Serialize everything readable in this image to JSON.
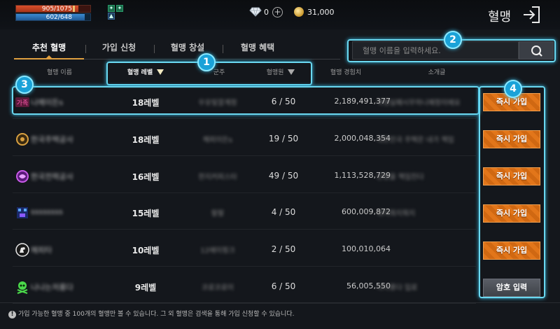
{
  "status": {
    "hp_text": "905/1075",
    "hp_fraction": 0.842,
    "mp_text": "602/648",
    "mp_fraction": 0.929
  },
  "currency": {
    "diamond": "0",
    "gold": "31,000"
  },
  "header": {
    "title": "혈맹"
  },
  "tabs": [
    {
      "label": "추천 혈맹",
      "active": true
    },
    {
      "label": "가입 신청",
      "active": false
    },
    {
      "label": "혈맹 창설",
      "active": false
    },
    {
      "label": "혈맹 혜택",
      "active": false
    }
  ],
  "search": {
    "placeholder": "혈맹 이름을 입력하세요."
  },
  "table": {
    "headers": [
      "혈맹 이름",
      "혈맹 레벨",
      "군주",
      "혈맹원",
      "혈맹 경험치",
      "소개글"
    ],
    "rows": [
      {
        "emblem": "text-emblem",
        "name": "나메이든s",
        "level": "18레벨",
        "leader": "우유빛깔계정",
        "members": "6 / 50",
        "exp": "2,189,491,377",
        "intro": "혁명실패시무하니예정이에요",
        "action": "즉시 가입"
      },
      {
        "emblem": "gold-wheel",
        "name": "한국주택공사",
        "level": "18레벨",
        "leader": "해피이든s",
        "members": "19 / 50",
        "exp": "2,000,048,354",
        "intro": "대한민국 주택은 내가 책임",
        "action": "즉시 가입"
      },
      {
        "emblem": "purple-orb",
        "name": "한국전력공사",
        "level": "16레벨",
        "leader": "한지커피스타",
        "members": "49 / 50",
        "exp": "1,113,528,729",
        "intro": "난방을 책임진다",
        "action": "즉시 가입"
      },
      {
        "emblem": "blue-pixel",
        "name": "ssssssss",
        "level": "15레벨",
        "leader": "랄랄",
        "members": "4 / 50",
        "exp": "600,009,872",
        "intro": "뭐지뭐지뭐지",
        "action": "즉시 가입"
      },
      {
        "emblem": "horse-badge",
        "name": "해피타",
        "level": "10레벨",
        "leader": "12에이핑크",
        "members": "2 / 50",
        "exp": "100,010,064",
        "intro": "",
        "action": "즉시 가입"
      },
      {
        "emblem": "green-skull",
        "name": "나나는저롱다",
        "level": "9레벨",
        "leader": "코로코로이",
        "members": "6 / 50",
        "exp": "56,005,550",
        "intro": "나나롱다 입로",
        "action": "암호 입력"
      }
    ]
  },
  "footer": {
    "notice": "가입 가능한 혈맹 중 100개의 혈맹만 볼 수 있습니다. 그 외 혈맹은 검색을 통해 가입 신청할 수 있습니다."
  },
  "callouts": [
    "1",
    "2",
    "3",
    "4"
  ],
  "colors": {
    "accent": "#e0a040",
    "join_button": "#e2761a",
    "callout": "#1aa2d8",
    "background": "#14171c"
  }
}
